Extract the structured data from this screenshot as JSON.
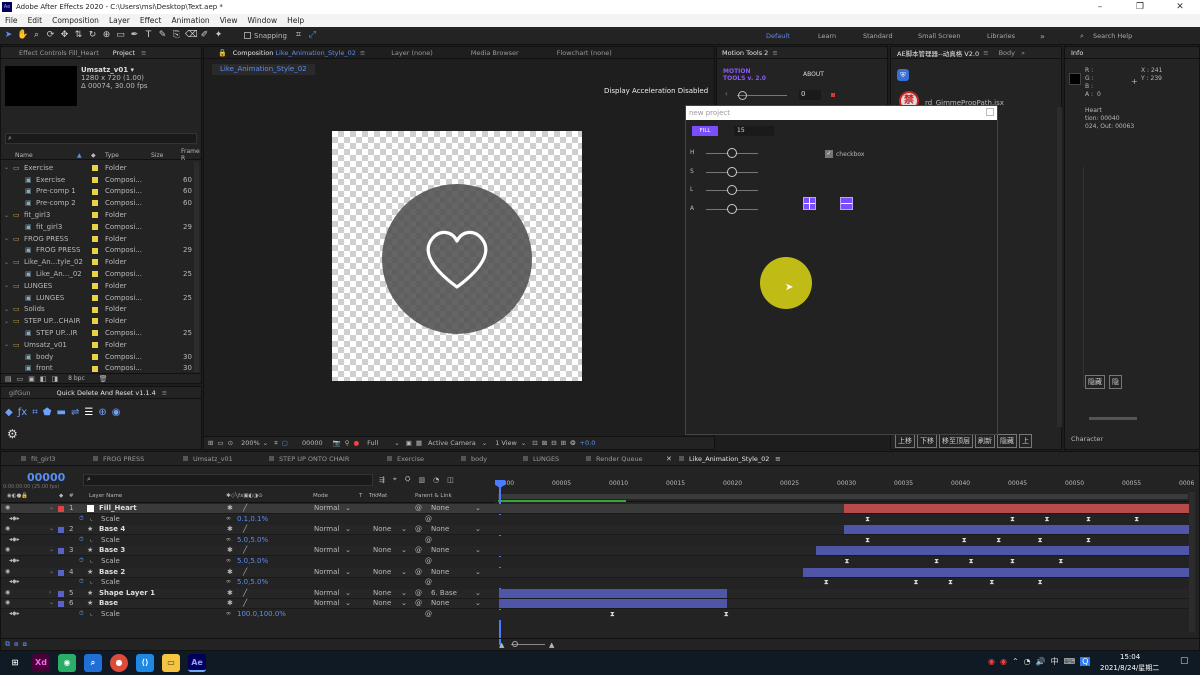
{
  "window": {
    "title": "Adobe After Effects 2020 - C:\\Users\\msi\\Desktop\\Text.aep *"
  },
  "menu": [
    "File",
    "Edit",
    "Composition",
    "Layer",
    "Effect",
    "Animation",
    "View",
    "Window",
    "Help"
  ],
  "toolbar": {
    "snapping": "Snapping"
  },
  "workspaces": [
    "Default",
    "Learn",
    "Standard",
    "Small Screen",
    "Libraries"
  ],
  "search_help": "Search Help",
  "tabs": {
    "effect_controls": "Effect Controls Fill_Heart",
    "project": "Project",
    "composition": "Composition",
    "comp_name": "Like_Animation_Style_02",
    "layer": "Layer (none)",
    "media_browser": "Media Browser",
    "flowchart": "Flowchart (none)",
    "motion_tools": "Motion Tools 2",
    "ae_manager": "AE脚本管理器--动真格 V2.0",
    "body": "Body",
    "info": "Info",
    "gifgun": "gifGun",
    "quick_delete": "Quick Delete And Reset v1.1.4",
    "character": "Character"
  },
  "project": {
    "selected": "Umsatz_v01 ▾",
    "size": "1280 x 720 (1.00)",
    "duration": "Δ 00074, 30.00 fps",
    "col_name": "Name",
    "col_type": "Type",
    "col_size": "Size",
    "col_frame": "Frame R",
    "items": [
      {
        "name": "Exercise",
        "type": "Folder",
        "size": "",
        "indent": 0,
        "color": "#e8d24a"
      },
      {
        "name": "Exercise",
        "type": "Composi...",
        "size": "60",
        "indent": 1,
        "color": "#e8d24a"
      },
      {
        "name": "Pre-comp 1",
        "type": "Composi...",
        "size": "60",
        "indent": 1,
        "color": "#e8d24a"
      },
      {
        "name": "Pre-comp 2",
        "type": "Composi...",
        "size": "60",
        "indent": 1,
        "color": "#e8d24a"
      },
      {
        "name": "fit_girl3",
        "type": "Folder",
        "size": "",
        "indent": 0,
        "color": "#e8d24a"
      },
      {
        "name": "fit_girl3",
        "type": "Composi...",
        "size": "29",
        "indent": 1,
        "color": "#e8d24a"
      },
      {
        "name": "FROG PRESS",
        "type": "Folder",
        "size": "",
        "indent": 0,
        "color": "#e8d24a"
      },
      {
        "name": "FROG PRESS",
        "type": "Composi...",
        "size": "29",
        "indent": 1,
        "color": "#e8d24a"
      },
      {
        "name": "Like_An...tyle_02",
        "type": "Folder",
        "size": "",
        "indent": 0,
        "color": "#e8d24a"
      },
      {
        "name": "Like_An..._02",
        "type": "Composi...",
        "size": "25",
        "indent": 1,
        "color": "#e8d24a"
      },
      {
        "name": "LUNGES",
        "type": "Folder",
        "size": "",
        "indent": 0,
        "color": "#e8d24a"
      },
      {
        "name": "LUNGES",
        "type": "Composi...",
        "size": "25",
        "indent": 1,
        "color": "#e8d24a"
      },
      {
        "name": "Solids",
        "type": "Folder",
        "size": "",
        "indent": 0,
        "color": "#e8d24a"
      },
      {
        "name": "STEP UP...CHAIR",
        "type": "Folder",
        "size": "",
        "indent": 0,
        "color": "#e8d24a"
      },
      {
        "name": "STEP UP...IR",
        "type": "Composi...",
        "size": "25",
        "indent": 1,
        "color": "#e8d24a"
      },
      {
        "name": "Umsatz_v01",
        "type": "Folder",
        "size": "",
        "indent": 0,
        "color": "#e8d24a"
      },
      {
        "name": "body",
        "type": "Composi...",
        "size": "30",
        "indent": 1,
        "color": "#e8d24a"
      },
      {
        "name": "front",
        "type": "Composi...",
        "size": "30",
        "indent": 1,
        "color": "#e8d24a"
      }
    ],
    "bpc": "8 bpc"
  },
  "viewer": {
    "display_accel": "Display Acceleration Disabled",
    "zoom": "200%",
    "timecode": "00000",
    "resolution": "Full",
    "camera": "Active Camera",
    "views": "1 View",
    "exposure": "+0.0"
  },
  "motion_tools": {
    "logo_line1": "MOTION",
    "logo_line2": "TOOLS v. 2.0",
    "about": "ABOUT",
    "value": "0"
  },
  "dialog": {
    "title": "new project",
    "fill_button": "FILL",
    "fill_value": "15",
    "sliders": [
      "H",
      "S",
      "L",
      "A"
    ],
    "checkbox": "checkbox"
  },
  "ae_manager": {
    "script": "rd_GimmePropPath.jsx"
  },
  "info": {
    "r": "R :",
    "g": "G :",
    "b": "B :",
    "a": "A :",
    "x": "X : 241",
    "y": "Y : 239",
    "a_val": "0",
    "layer": "Heart",
    "dur": "tion: 00040",
    "inout": "024, Out: 00063"
  },
  "right_buttons": [
    "上移",
    "下移",
    "移至顶层",
    "刷新",
    "隐藏",
    "上"
  ],
  "right_buttons2": [
    "隐藏",
    "隐"
  ],
  "timeline": {
    "tabs": [
      "fit_girl3",
      "FROG PRESS",
      "Umsatz_v01",
      "STEP UP ONTO CHAIR",
      "Exercise",
      "body",
      "LUNGES",
      "Render Queue",
      "Like_Animation_Style_02"
    ],
    "timecode": "00000",
    "fps": "0:00:00:00 (25.00 fps)",
    "col_layer_name": "Layer Name",
    "col_mode": "Mode",
    "col_t": "T",
    "col_trkmat": "TrkMat",
    "col_parent": "Parent & Link",
    "ruler": [
      "00000",
      "00005",
      "00010",
      "00015",
      "00020",
      "00025",
      "00030",
      "00035",
      "00040",
      "00045",
      "00050",
      "00055",
      "0006"
    ],
    "layers": [
      {
        "num": "1",
        "name": "Fill_Heart",
        "mode": "Normal",
        "trkmat": "",
        "parent": "None",
        "prop": "Scale",
        "value": "0.1,0.1%",
        "color": "#d44",
        "selected": true,
        "start": 0.5,
        "end": 1.0,
        "bar": "#b94a4a",
        "keys": [
          0.535,
          0.745,
          0.795,
          0.855,
          0.925
        ]
      },
      {
        "num": "2",
        "name": "Base 4",
        "mode": "Normal",
        "trkmat": "None",
        "parent": "None",
        "prop": "Scale",
        "value": "5.0,5.0%",
        "color": "#5a62c8",
        "selected": false,
        "start": 0.5,
        "end": 1.0,
        "bar": "#4f56a8",
        "keys": [
          0.535,
          0.675,
          0.725,
          0.785,
          0.855
        ]
      },
      {
        "num": "3",
        "name": "Base 3",
        "mode": "Normal",
        "trkmat": "None",
        "parent": "None",
        "prop": "Scale",
        "value": "5.0,5.0%",
        "color": "#5a62c8",
        "selected": false,
        "start": 0.46,
        "end": 1.0,
        "bar": "#4f56a8",
        "keys": [
          0.505,
          0.635,
          0.685,
          0.745,
          0.815
        ]
      },
      {
        "num": "4",
        "name": "Base 2",
        "mode": "Normal",
        "trkmat": "None",
        "parent": "None",
        "prop": "Scale",
        "value": "5.0,5.0%",
        "color": "#5a62c8",
        "selected": false,
        "start": 0.44,
        "end": 1.0,
        "bar": "#4f56a8",
        "keys": [
          0.475,
          0.605,
          0.655,
          0.715,
          0.785
        ]
      },
      {
        "num": "5",
        "name": "Shape Layer 1",
        "mode": "Normal",
        "trkmat": "None",
        "parent": "6. Base",
        "prop": "",
        "value": "",
        "color": "#5a62c8",
        "selected": false,
        "start": 0.0,
        "end": 0.33,
        "bar": "#4f56a8",
        "keys": []
      },
      {
        "num": "6",
        "name": "Base",
        "mode": "Normal",
        "trkmat": "None",
        "parent": "None",
        "prop": "Scale",
        "value": "100.0,100.0%",
        "color": "#5a62c8",
        "selected": false,
        "start": 0.0,
        "end": 0.33,
        "bar": "#4f56a8",
        "keys": [
          0.165,
          0.33
        ]
      }
    ]
  },
  "taskbar": {
    "time": "15:04",
    "date": "2021/8/24/星期二",
    "ime": "中"
  }
}
